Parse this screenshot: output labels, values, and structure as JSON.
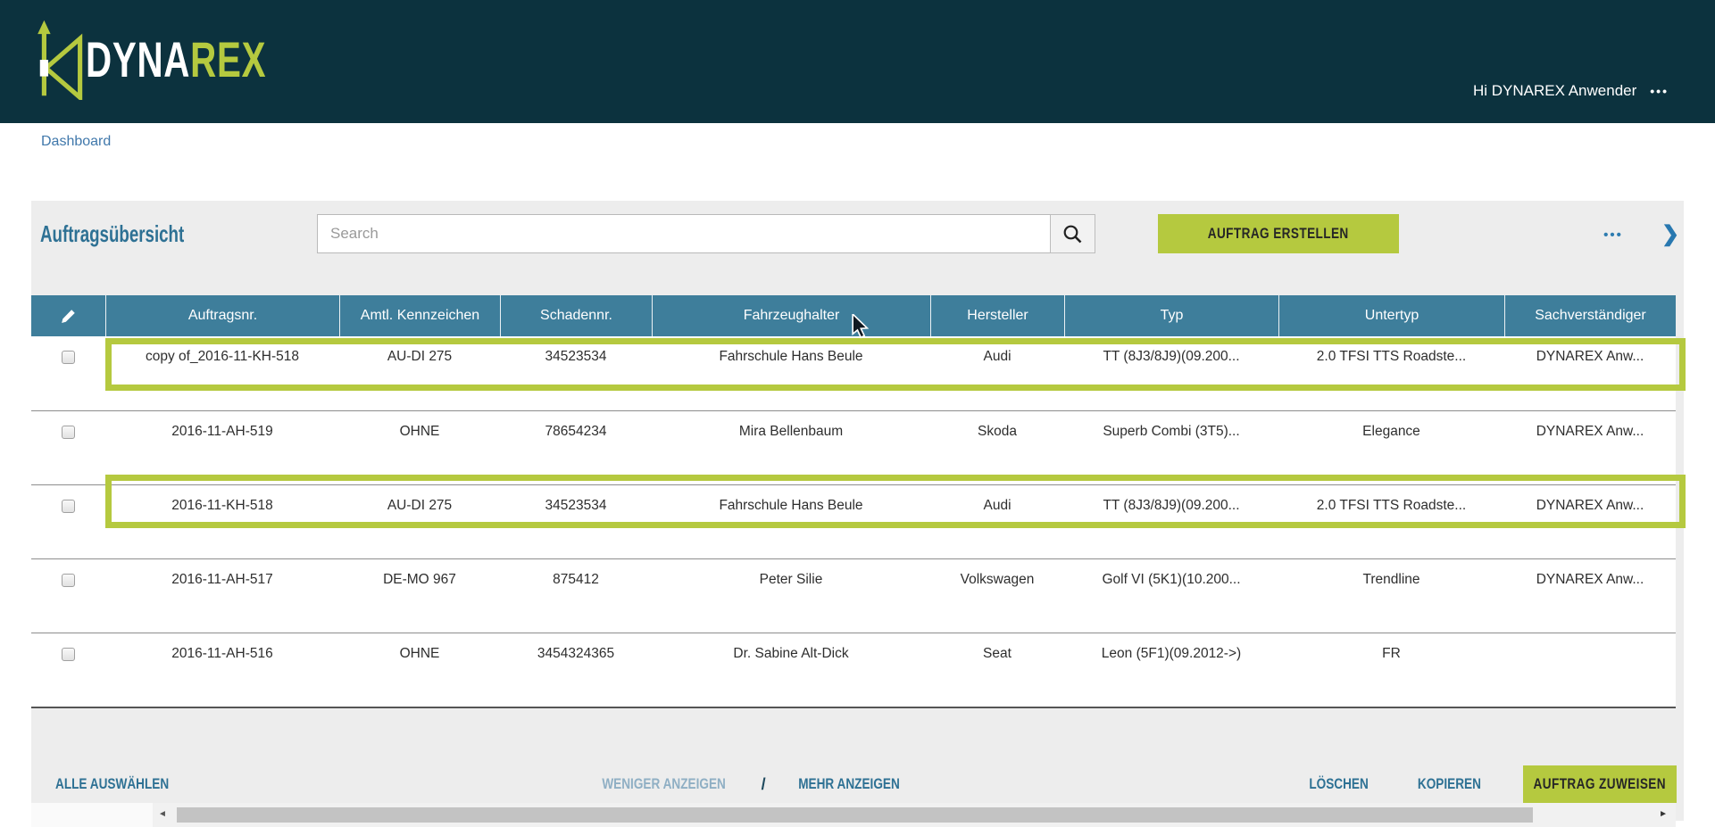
{
  "colors": {
    "header_bg": "#0c323e",
    "accent_green": "#b5c93f",
    "table_header_bg": "#3e7e9b",
    "link_blue": "#4078ab",
    "teal": "#2e7194",
    "muted_link": "#8fafc4",
    "card_bg": "#ededed"
  },
  "header": {
    "logo_primary": "DYNA",
    "logo_accent": "REX",
    "greeting": "Hi DYNAREX Anwender",
    "menu_dots": "•••"
  },
  "breadcrumb": {
    "label": "Dashboard"
  },
  "toolbar": {
    "title": "Auftragsübersicht",
    "search_placeholder": "Search",
    "search_value": "",
    "create_button_label": "AUFTRAG ERSTELLEN",
    "more_dots": "•••",
    "expand_chevron": "❯"
  },
  "table": {
    "columns": [
      {
        "key": "auftragsnr",
        "label": "Auftragsnr."
      },
      {
        "key": "kennzeichen",
        "label": "Amtl. Kennzeichen"
      },
      {
        "key": "schadennr",
        "label": "Schadennr."
      },
      {
        "key": "fahrzeughalter",
        "label": "Fahrzeughalter"
      },
      {
        "key": "hersteller",
        "label": "Hersteller"
      },
      {
        "key": "typ",
        "label": "Typ"
      },
      {
        "key": "untertyp",
        "label": "Untertyp"
      },
      {
        "key": "sachverstaendiger",
        "label": "Sachverständiger"
      }
    ],
    "rows": [
      {
        "auftragsnr": "copy of_2016-11-KH-518",
        "kennzeichen": "AU-DI 275",
        "schadennr": "34523534",
        "fahrzeughalter": "Fahrschule Hans Beule",
        "hersteller": "Audi",
        "typ": "TT (8J3/8J9)(09.200...",
        "untertyp": "2.0 TFSI TTS Roadste...",
        "sachverstaendiger": "DYNAREX Anw...",
        "highlighted": true,
        "checked": false
      },
      {
        "auftragsnr": "2016-11-AH-519",
        "kennzeichen": "OHNE",
        "schadennr": "78654234",
        "fahrzeughalter": "Mira Bellenbaum",
        "hersteller": "Skoda",
        "typ": "Superb Combi (3T5)...",
        "untertyp": "Elegance",
        "sachverstaendiger": "DYNAREX Anw...",
        "highlighted": false,
        "checked": false
      },
      {
        "auftragsnr": "2016-11-KH-518",
        "kennzeichen": "AU-DI 275",
        "schadennr": "34523534",
        "fahrzeughalter": "Fahrschule Hans Beule",
        "hersteller": "Audi",
        "typ": "TT (8J3/8J9)(09.200...",
        "untertyp": "2.0 TFSI TTS Roadste...",
        "sachverstaendiger": "DYNAREX Anw...",
        "highlighted": true,
        "checked": false
      },
      {
        "auftragsnr": "2016-11-AH-517",
        "kennzeichen": "DE-MO 967",
        "schadennr": "875412",
        "fahrzeughalter": "Peter Silie",
        "hersteller": "Volkswagen",
        "typ": "Golf VI (5K1)(10.200...",
        "untertyp": "Trendline",
        "sachverstaendiger": "DYNAREX Anw...",
        "highlighted": false,
        "checked": false
      },
      {
        "auftragsnr": "2016-11-AH-516",
        "kennzeichen": "OHNE",
        "schadennr": "3454324365",
        "fahrzeughalter": "Dr. Sabine Alt-Dick",
        "hersteller": "Seat",
        "typ": "Leon (5F1)(09.2012->)",
        "untertyp": "FR",
        "sachverstaendiger": "",
        "highlighted": false,
        "checked": false
      }
    ]
  },
  "scrollbar": {
    "left_arrow": "◄",
    "right_arrow": "►"
  },
  "footer": {
    "select_all_label": "ALLE AUSWÄHLEN",
    "show_less_label": "WENIGER ANZEIGEN",
    "separator": "/",
    "show_more_label": "MEHR ANZEIGEN",
    "delete_label": "LÖSCHEN",
    "copy_label": "KOPIEREN",
    "assign_label": "AUFTRAG ZUWEISEN"
  }
}
